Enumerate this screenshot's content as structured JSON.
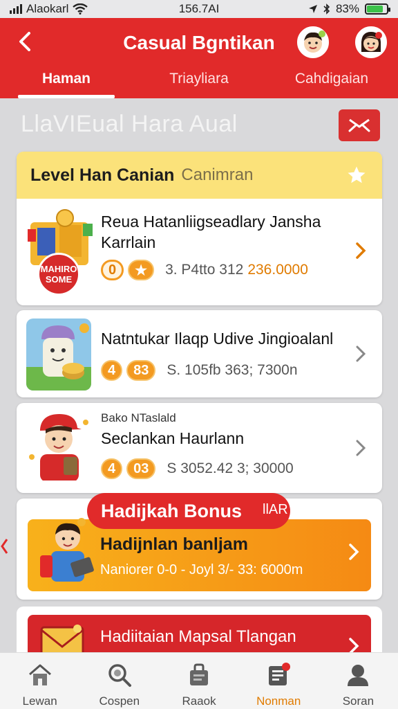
{
  "status_bar": {
    "carrier": "Alaokarl",
    "time": "156.7AI",
    "battery_pct": "83%",
    "battery_level": 0.83
  },
  "header": {
    "title": "Casual Bgntikan",
    "tabs": [
      {
        "label": "Haman",
        "active": true
      },
      {
        "label": "Triayliara",
        "active": false
      },
      {
        "label": "Cahdigaian",
        "active": false
      }
    ]
  },
  "page_heading": "LlaVIEual Hara Aual",
  "level": {
    "title": "Level Han Canian",
    "subtitle": "Canimran"
  },
  "tasks": [
    {
      "title_line1": "Reua Hatanliigseadlary Jansha",
      "title_line2": "Karrlain",
      "badge_text": "MAHIRO SOME",
      "pill1": "0",
      "pill2": "★",
      "meta": "3. P4tto 312",
      "meta_accent": "236.0000"
    },
    {
      "title_line1": "Natntukar Ilaqp Udive Jingioalanl",
      "pill1": "4",
      "pill2": "83",
      "meta": "S. 105fb 363; 7300n"
    },
    {
      "small_label": "Bako NTaslald",
      "title_line1": "Seclankan Haurlann",
      "pill1": "4",
      "pill2": "03",
      "meta": "S  3052.42 3; 30000"
    }
  ],
  "bonus": {
    "pill_label": "Hadijkah Bonus",
    "pill_tail": "llAR",
    "title": "Hadijnlan banljam",
    "subtitle": "Naniorer 0-0 - Joyl 3/- 33: 6000m"
  },
  "promo": {
    "title": "Hadiitaian Mapsal Tlangan"
  },
  "bottom_nav": [
    {
      "label": "Lewan",
      "icon": "home-icon",
      "active": false
    },
    {
      "label": "Cospen",
      "icon": "search-icon",
      "active": false
    },
    {
      "label": "Raaok",
      "icon": "bag-icon",
      "active": false
    },
    {
      "label": "Nonman",
      "icon": "notes-icon",
      "active": true
    },
    {
      "label": "Soran",
      "icon": "profile-icon",
      "active": false
    }
  ],
  "colors": {
    "brand_red": "#e12a2a",
    "accent_orange": "#f39a21",
    "level_yellow": "#fbe27a"
  }
}
